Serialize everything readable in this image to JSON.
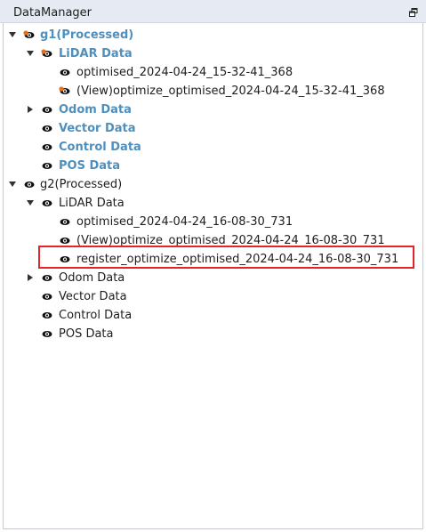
{
  "panel": {
    "title": "DataManager"
  },
  "colors": {
    "title_bar": "#e6eaf2",
    "highlight_text": "#4f8fbe",
    "orange_marker": "#e8711a",
    "selection_border": "#e0262b"
  },
  "tree": {
    "g1": {
      "label": "g1(Processed)",
      "lidar": {
        "label": "LiDAR Data",
        "items": [
          "optimised_2024-04-24_15-32-41_368",
          "(View)optimize_optimised_2024-04-24_15-32-41_368"
        ]
      },
      "odom": "Odom Data",
      "vector": "Vector Data",
      "control": "Control Data",
      "pos": "POS Data"
    },
    "g2": {
      "label": "g2(Processed)",
      "lidar": {
        "label": "LiDAR Data",
        "items": [
          "optimised_2024-04-24_16-08-30_731",
          "(View)optimize_optimised_2024-04-24_16-08-30_731",
          "register_optimize_optimised_2024-04-24_16-08-30_731"
        ]
      },
      "odom": "Odom Data",
      "vector": "Vector Data",
      "control": "Control Data",
      "pos": "POS Data"
    }
  }
}
